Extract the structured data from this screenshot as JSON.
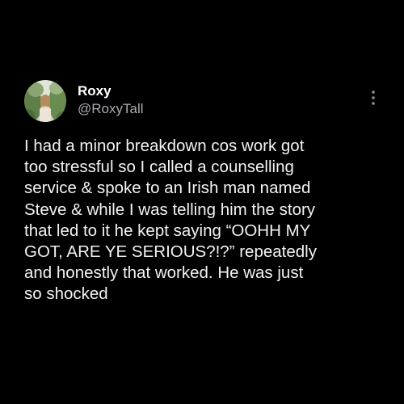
{
  "author": {
    "display_name": "Roxy",
    "handle": "@RoxyTall",
    "avatar_icon": "avatar-photo"
  },
  "menu": {
    "icon": "more-options-icon"
  },
  "tweet": {
    "lines": [
      "I had a minor breakdown cos work got",
      "too stressful so I called a counselling",
      "service & spoke to an Irish man named",
      "Steve & while I was telling him the story",
      "that led to it he kept saying “OOHH MY",
      "GOT, ARE YE SERIOUS?!?” repeatedly",
      "and honestly that worked. He was just",
      "so shocked"
    ]
  },
  "colors": {
    "background": "#000000",
    "text": "#f2f2f2",
    "secondary_text": "#a7abb0"
  }
}
